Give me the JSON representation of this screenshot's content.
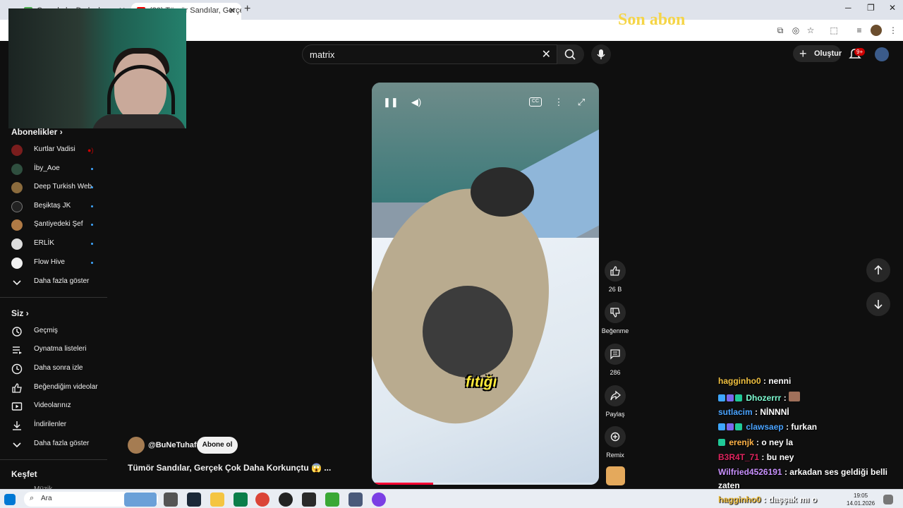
{
  "browser": {
    "tabs": [
      {
        "label": "C... ...l ..l ...D...l ...l..."
      },
      {
        "label": "(20) Tümör Sandılar, Gerçe"
      }
    ],
    "new_tab": "+",
    "win_min": "─",
    "win_max": "❐",
    "win_close": "✕"
  },
  "overlay_text": "Son abon",
  "search": {
    "value": "matrix",
    "clear": "✕"
  },
  "header": {
    "create_label": "Oluştur",
    "create_plus": "+",
    "notif_count": "9+"
  },
  "sidebar": {
    "subscriptions_title": "Abonelikler",
    "subscriptions": [
      {
        "label": "Kurtlar Vadisi",
        "color": "#7a1d1d",
        "indicator": "live"
      },
      {
        "label": "İby_Aoe",
        "color": "#2f4f3f",
        "indicator": "new"
      },
      {
        "label": "Deep Turkish Web",
        "color": "#8b6b3d",
        "indicator": "new"
      },
      {
        "label": "Beşiktaş JK",
        "color": "#222222",
        "indicator": "new"
      },
      {
        "label": "Şantiyedeki Şef",
        "color": "#b07a45",
        "indicator": "new"
      },
      {
        "label": "ERLİK",
        "color": "#dddddd",
        "indicator": "new"
      },
      {
        "label": "Flow Hive",
        "color": "#f0f0f0",
        "indicator": "new"
      }
    ],
    "show_more": "Daha fazla göster",
    "you_title": "Siz",
    "you_items": [
      {
        "label": "Geçmiş",
        "icon": "history-icon"
      },
      {
        "label": "Oynatma listeleri",
        "icon": "playlist-icon"
      },
      {
        "label": "Daha sonra izle",
        "icon": "clock-icon"
      },
      {
        "label": "Beğendiğim videolar",
        "icon": "like-icon"
      },
      {
        "label": "Videolarınız",
        "icon": "video-icon"
      },
      {
        "label": "İndirilenler",
        "icon": "download-icon"
      }
    ],
    "show_more_2": "Daha fazla göster",
    "explore_title": "Keşfet",
    "explore_first": "Müzik"
  },
  "video": {
    "caption": "fıtığı",
    "progress_fraction": 0.27
  },
  "actions": {
    "like_count": "26 B",
    "dislike_label": "Beğenme",
    "comment_count": "286",
    "share_label": "Paylaş",
    "remix_label": "Remix"
  },
  "channel": {
    "handle": "@BuNeTuhaf",
    "subscribe_label": "Abone ol"
  },
  "video_title": "Tümör Sandılar, Gerçek Çok Daha Korkunçtu 😱 ...",
  "chat": [
    {
      "user": "hagginho0",
      "text": ": nenni",
      "color": "#f0c040"
    },
    {
      "user": "Dhozerrr",
      "text": ":",
      "color": "#7fffd4"
    },
    {
      "user": "sutlacim",
      "text": ": NİNNNİ",
      "color": "#4aa3ff"
    },
    {
      "user": "clawsaep",
      "text": ": furkan",
      "color": "#4aa3ff"
    },
    {
      "user": "erenjk",
      "text": ": o ney la",
      "color": "#ffb347"
    },
    {
      "user": "B3R4T_71",
      "text": ": bu ney",
      "color": "#e0245e"
    },
    {
      "user": "Wilfried4526191",
      "text": ": arkadan ses geldiği belli",
      "color": "#c991ff"
    },
    {
      "user": "",
      "text": "zaten",
      "color": "#ffffff"
    },
    {
      "user": "hagginho0",
      "text": ": daşşak mı o",
      "color": "#f0c040"
    }
  ],
  "taskbar": {
    "search_placeholder": "Ara",
    "time": "19:05",
    "date": "14.01.2026"
  }
}
